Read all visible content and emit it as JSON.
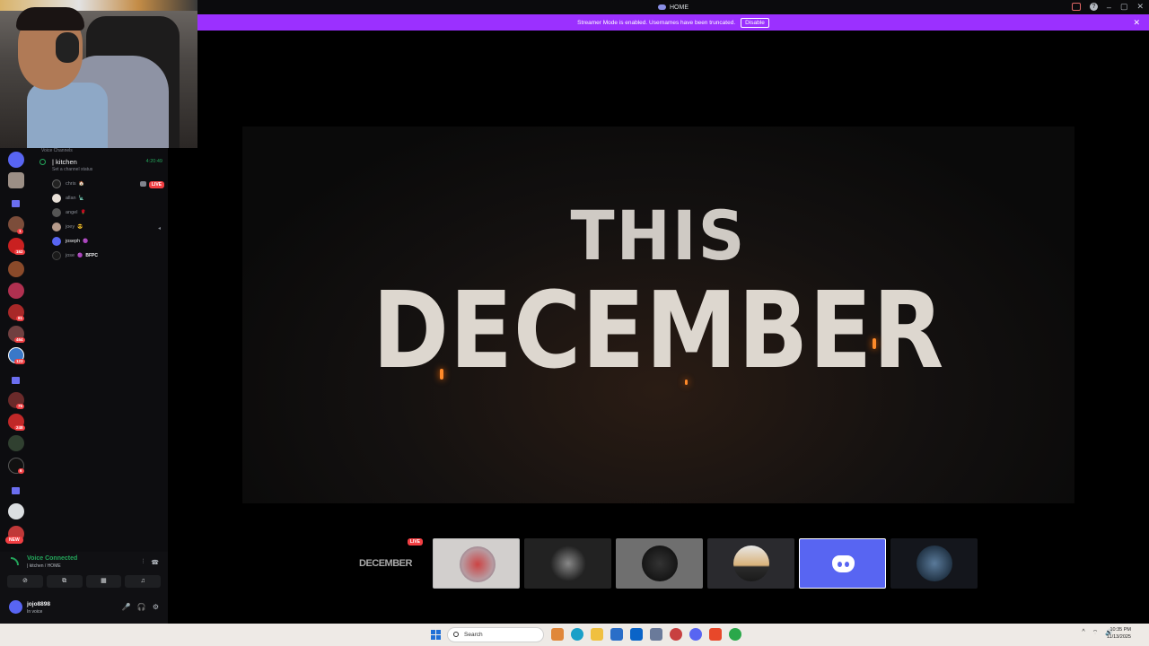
{
  "titlebar": {
    "title": "HOME"
  },
  "streamer_bar": {
    "message": "Streamer Mode is enabled. Usernames have been truncated.",
    "disable_label": "Disable",
    "close_glyph": "✕"
  },
  "rail": {
    "badges": [
      "1",
      "162",
      "81",
      "464",
      "123",
      "75",
      "248",
      "6"
    ],
    "new_label": "NEW"
  },
  "voice_channel": {
    "section_label": "Voice Channels",
    "name": "| kitchen",
    "elapsed": "4:20:49",
    "status_placeholder": "Set a channel status",
    "live_label": "LIVE",
    "members": [
      {
        "name": "chris",
        "emoji": "🏠"
      },
      {
        "name": "allan",
        "emoji": "🗽"
      },
      {
        "name": "angel",
        "emoji": "🌹"
      },
      {
        "name": "joey",
        "emoji": "😎"
      },
      {
        "name": "joseph",
        "emoji": "🟣"
      },
      {
        "name": "jose",
        "emoji": "🟣",
        "extra": "BFPC"
      }
    ]
  },
  "voice_status": {
    "connected_label": "Voice Connected",
    "location": "| kitchen / HOME"
  },
  "user": {
    "name": "jojo8898",
    "status": "In voice"
  },
  "stream": {
    "line1": "THIS",
    "line2": "DECEMBER"
  },
  "tiles": {
    "tile0_text": "DECEMBER",
    "tile0_live": "LIVE"
  },
  "taskbar": {
    "search_placeholder": "Search",
    "time": "10:35 PM",
    "date": "11/13/2025"
  },
  "colors": {
    "streamer_purple": "#9b30ff",
    "discord_blurple": "#5865f2",
    "live_red": "#f23f43",
    "voice_green": "#23a55a"
  }
}
